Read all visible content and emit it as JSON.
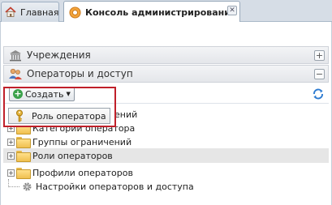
{
  "tabs": [
    {
      "label": "Главная",
      "icon": "home-icon",
      "active": false
    },
    {
      "label": "Консоль администрирования",
      "icon": "settings-icon",
      "active": true,
      "close_label": "✕"
    }
  ],
  "sections": [
    {
      "label": "Учреждения",
      "icon": "building-icon",
      "toggle": "+"
    },
    {
      "label": "Операторы и доступ",
      "icon": "users-icon",
      "toggle": "−"
    }
  ],
  "toolbar": {
    "create_label": "Создать",
    "refresh_icon": "refresh-icon"
  },
  "menu": {
    "items": [
      {
        "label": "Роль оператора",
        "icon": "key-icon"
      }
    ]
  },
  "tree": {
    "items": [
      {
        "label": "…ений",
        "expander": "+",
        "type": "folder",
        "selected": false
      },
      {
        "label": "Категории оператора",
        "expander": "+",
        "type": "folder",
        "selected": false
      },
      {
        "label": "Группы ограничений",
        "expander": "+",
        "type": "folder",
        "selected": false
      },
      {
        "label": "Роли операторов",
        "expander": "+",
        "type": "folder",
        "selected": true
      },
      {
        "label": "Профили операторов",
        "expander": "+",
        "type": "folder",
        "selected": false
      },
      {
        "label": "Настройки операторов и доступа",
        "expander": "",
        "type": "settings",
        "selected": false
      }
    ]
  },
  "colors": {
    "highlight_border": "#c0202a",
    "accent_green": "#3aa14a",
    "folder": "#f0c050"
  }
}
